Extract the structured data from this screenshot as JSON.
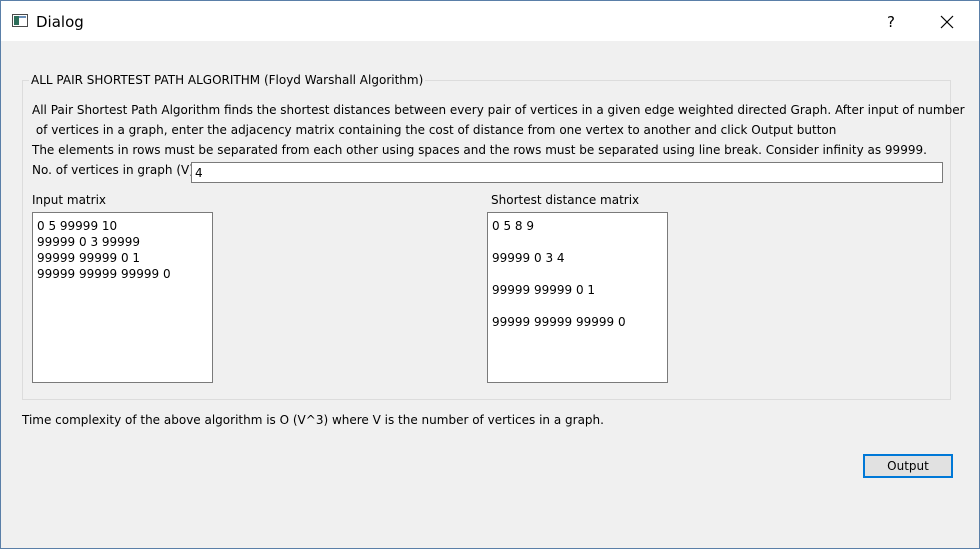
{
  "window": {
    "title": "Dialog",
    "help_label": "?"
  },
  "group": {
    "title": "ALL PAIR SHORTEST PATH ALGORITHM (Floyd Warshall Algorithm)",
    "description_lines": [
      "All Pair Shortest Path Algorithm finds the shortest distances between every pair of vertices in a given edge weighted directed Graph. After input of  number",
      " of vertices in a graph, enter the adjacency matrix containing the cost of distance from one vertex to another and click Output button",
      "The elements in rows must be separated from each other using spaces and the rows must be separated using line break. Consider infinity as 99999."
    ],
    "vertices_label": "No. of vertices in graph (V)",
    "vertices_value": "4",
    "input_matrix_label": "Input matrix",
    "input_matrix_lines": [
      "0 5 99999 10",
      "99999 0 3 99999",
      "99999 99999 0 1",
      "99999 99999 99999 0"
    ],
    "output_matrix_label": "Shortest distance matrix",
    "output_matrix_lines": [
      "0 5 8 9",
      "99999 0 3 4",
      "99999 99999 0 1",
      "99999 99999 99999 0"
    ]
  },
  "complexity_note": "Time complexity of the above algorithm is O (V^3) where V is the number of vertices in a graph.",
  "output_button_label": "Output"
}
